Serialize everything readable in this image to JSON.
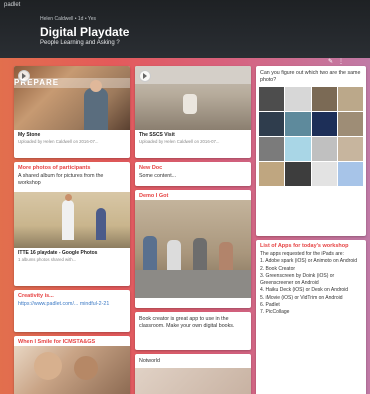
{
  "header": {
    "brand": "padlet",
    "breadcrumb": "Helen Caldwell • 1d • Yes",
    "title": "Digital Playdate",
    "subtitle": "People Learning and Asking ?"
  },
  "columns": {
    "col1": [
      {
        "type": "photo",
        "caption": "My Stone",
        "meta": "Uploaded by Helen Caldwell on 2016-07..."
      },
      {
        "type": "text",
        "title": "More photos of participants",
        "body": "A shared album for pictures from the workshop"
      },
      {
        "type": "photo",
        "caption": "ITTE 16 playdate - Google Photos",
        "meta": "1 albums photos shared with..."
      },
      {
        "type": "link",
        "title": "Creativity is...",
        "link": "https://www.padlet.com/... mindful-2-21"
      },
      {
        "type": "photo",
        "title": "When I Smile for ICMSTA&GS"
      }
    ],
    "col2": [
      {
        "type": "photo",
        "caption": "The SSCS Visit",
        "meta": "Uploaded by Helen Caldwell on 2016-07..."
      },
      {
        "type": "text",
        "title": "New Doc",
        "body": "Some content..."
      },
      {
        "type": "photo",
        "title": "Demo I Got"
      },
      {
        "type": "text",
        "body": "Book creator is great app to use in the classroom. Make your own digital books."
      },
      {
        "type": "text",
        "body": "Notworld"
      }
    ],
    "col3": {
      "question": "Can you figure out which two are the same photo?",
      "list_title": "List of Apps for today's workshop",
      "list_intro": "The apps requested for the iPads are:",
      "apps": [
        "1. Adobe spark (iOS) or Animoto on Android",
        "2. Book Creator",
        "3. Greenscreen by Doink (iOS) or Greenscreener on Android",
        "4. Haiku Deck (iOS) or Desk on Android",
        "5. iMovie (iOS) or VidTrim on Android",
        "6. Padlet",
        "7. PicCollage"
      ]
    }
  },
  "icons": {
    "play": "play-icon",
    "toolbar": [
      "edit-icon",
      "menu-icon"
    ]
  },
  "colors": {
    "header_bg": "#23272b",
    "canvas_left": "#e26f4d",
    "canvas_right": "#c07aa6",
    "title_red": "#e64343"
  }
}
